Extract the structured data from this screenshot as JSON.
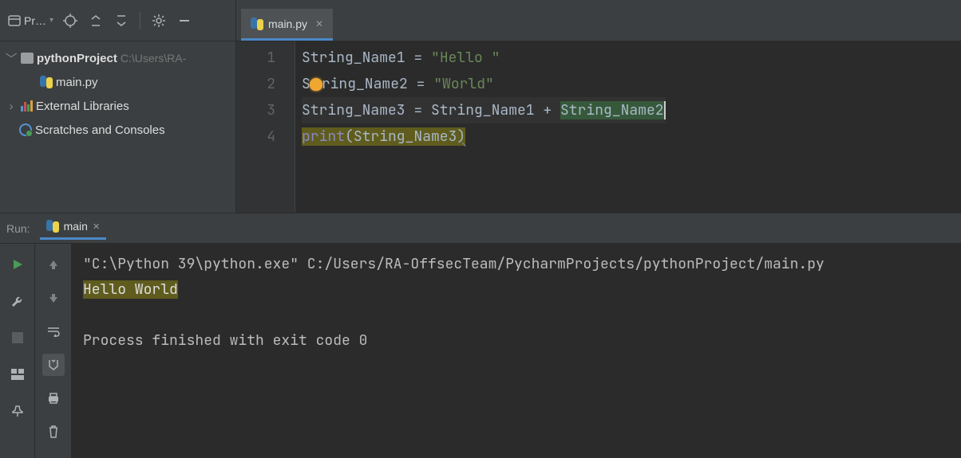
{
  "sidebar": {
    "label": "Pr…",
    "project": {
      "name": "pythonProject",
      "path": "C:\\Users\\RA-"
    },
    "files": [
      {
        "name": "main.py"
      }
    ],
    "external_libraries_label": "External Libraries",
    "scratches_label": "Scratches and Consoles"
  },
  "editor": {
    "tab": {
      "file": "main.py"
    },
    "lines": {
      "n1": "1",
      "n2": "2",
      "n3": "3",
      "n4": "4",
      "l1_var": "String_Name1",
      "l1_eq": " = ",
      "l1_str": "\"Hello \"",
      "l2_pre": "S",
      "l2_post": "ring_Name2",
      "l2_eq": " = ",
      "l2_str": "\"World\"",
      "l3": "String_Name3 = String_Name1 + ",
      "l3_sel": "String_Name2",
      "l4_fn": "print",
      "l4_open": "(",
      "l4_arg": "String_Name3",
      "l4_close": ")"
    }
  },
  "run": {
    "label": "Run:",
    "tab_name": "main",
    "cmd": "\"C:\\Python 39\\python.exe\" C:/Users/RA-OffsecTeam/PycharmProjects/pythonProject/main.py",
    "output": "Hello World",
    "exit": "Process finished with exit code 0"
  }
}
